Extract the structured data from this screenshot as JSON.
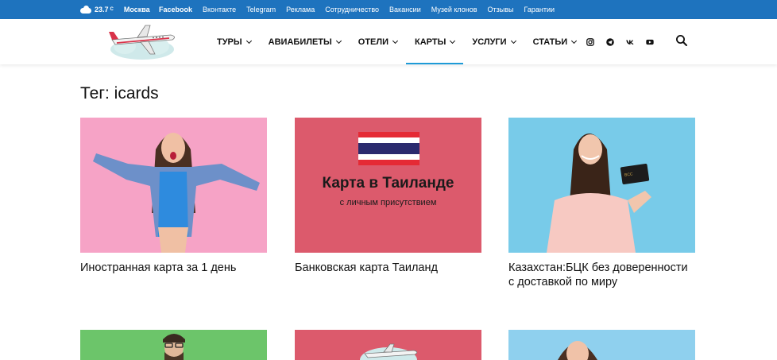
{
  "topbar": {
    "temperature": "23.7",
    "temp_unit": "C",
    "city": "Москва",
    "links": [
      "Facebook",
      "Вконтакте",
      "Telegram",
      "Реклама",
      "Сотрудничество",
      "Вакансии",
      "Музей клонов",
      "Отзывы",
      "Гарантии"
    ]
  },
  "nav": {
    "items": [
      {
        "label": "ТУРЫ"
      },
      {
        "label": "АВИАБИЛЕТЫ"
      },
      {
        "label": "ОТЕЛИ"
      },
      {
        "label": "КАРТЫ"
      },
      {
        "label": "УСЛУГИ"
      },
      {
        "label": "СТАТЬИ"
      }
    ],
    "active": "КАРТЫ"
  },
  "socials": [
    "instagram-icon",
    "telegram-icon",
    "vk-icon",
    "youtube-icon"
  ],
  "page": {
    "title": "Тег: icards"
  },
  "posts": [
    {
      "title": "Иностранная карта за 1 день"
    },
    {
      "title": "Банковская карта Таиланд",
      "promo_title": "Карта в Таиланде",
      "promo_sub": "с личным присутствием"
    },
    {
      "title": "Казахстан:БЦК без доверенности с доставкой по миру"
    }
  ],
  "colors": {
    "topbar": "#1e73be",
    "active_underline": "#1e9bd7",
    "card_pink": "#f6a3c6",
    "card_red": "#dc5a6c",
    "card_blue": "#78cbe9",
    "card_green": "#6cc56a"
  }
}
